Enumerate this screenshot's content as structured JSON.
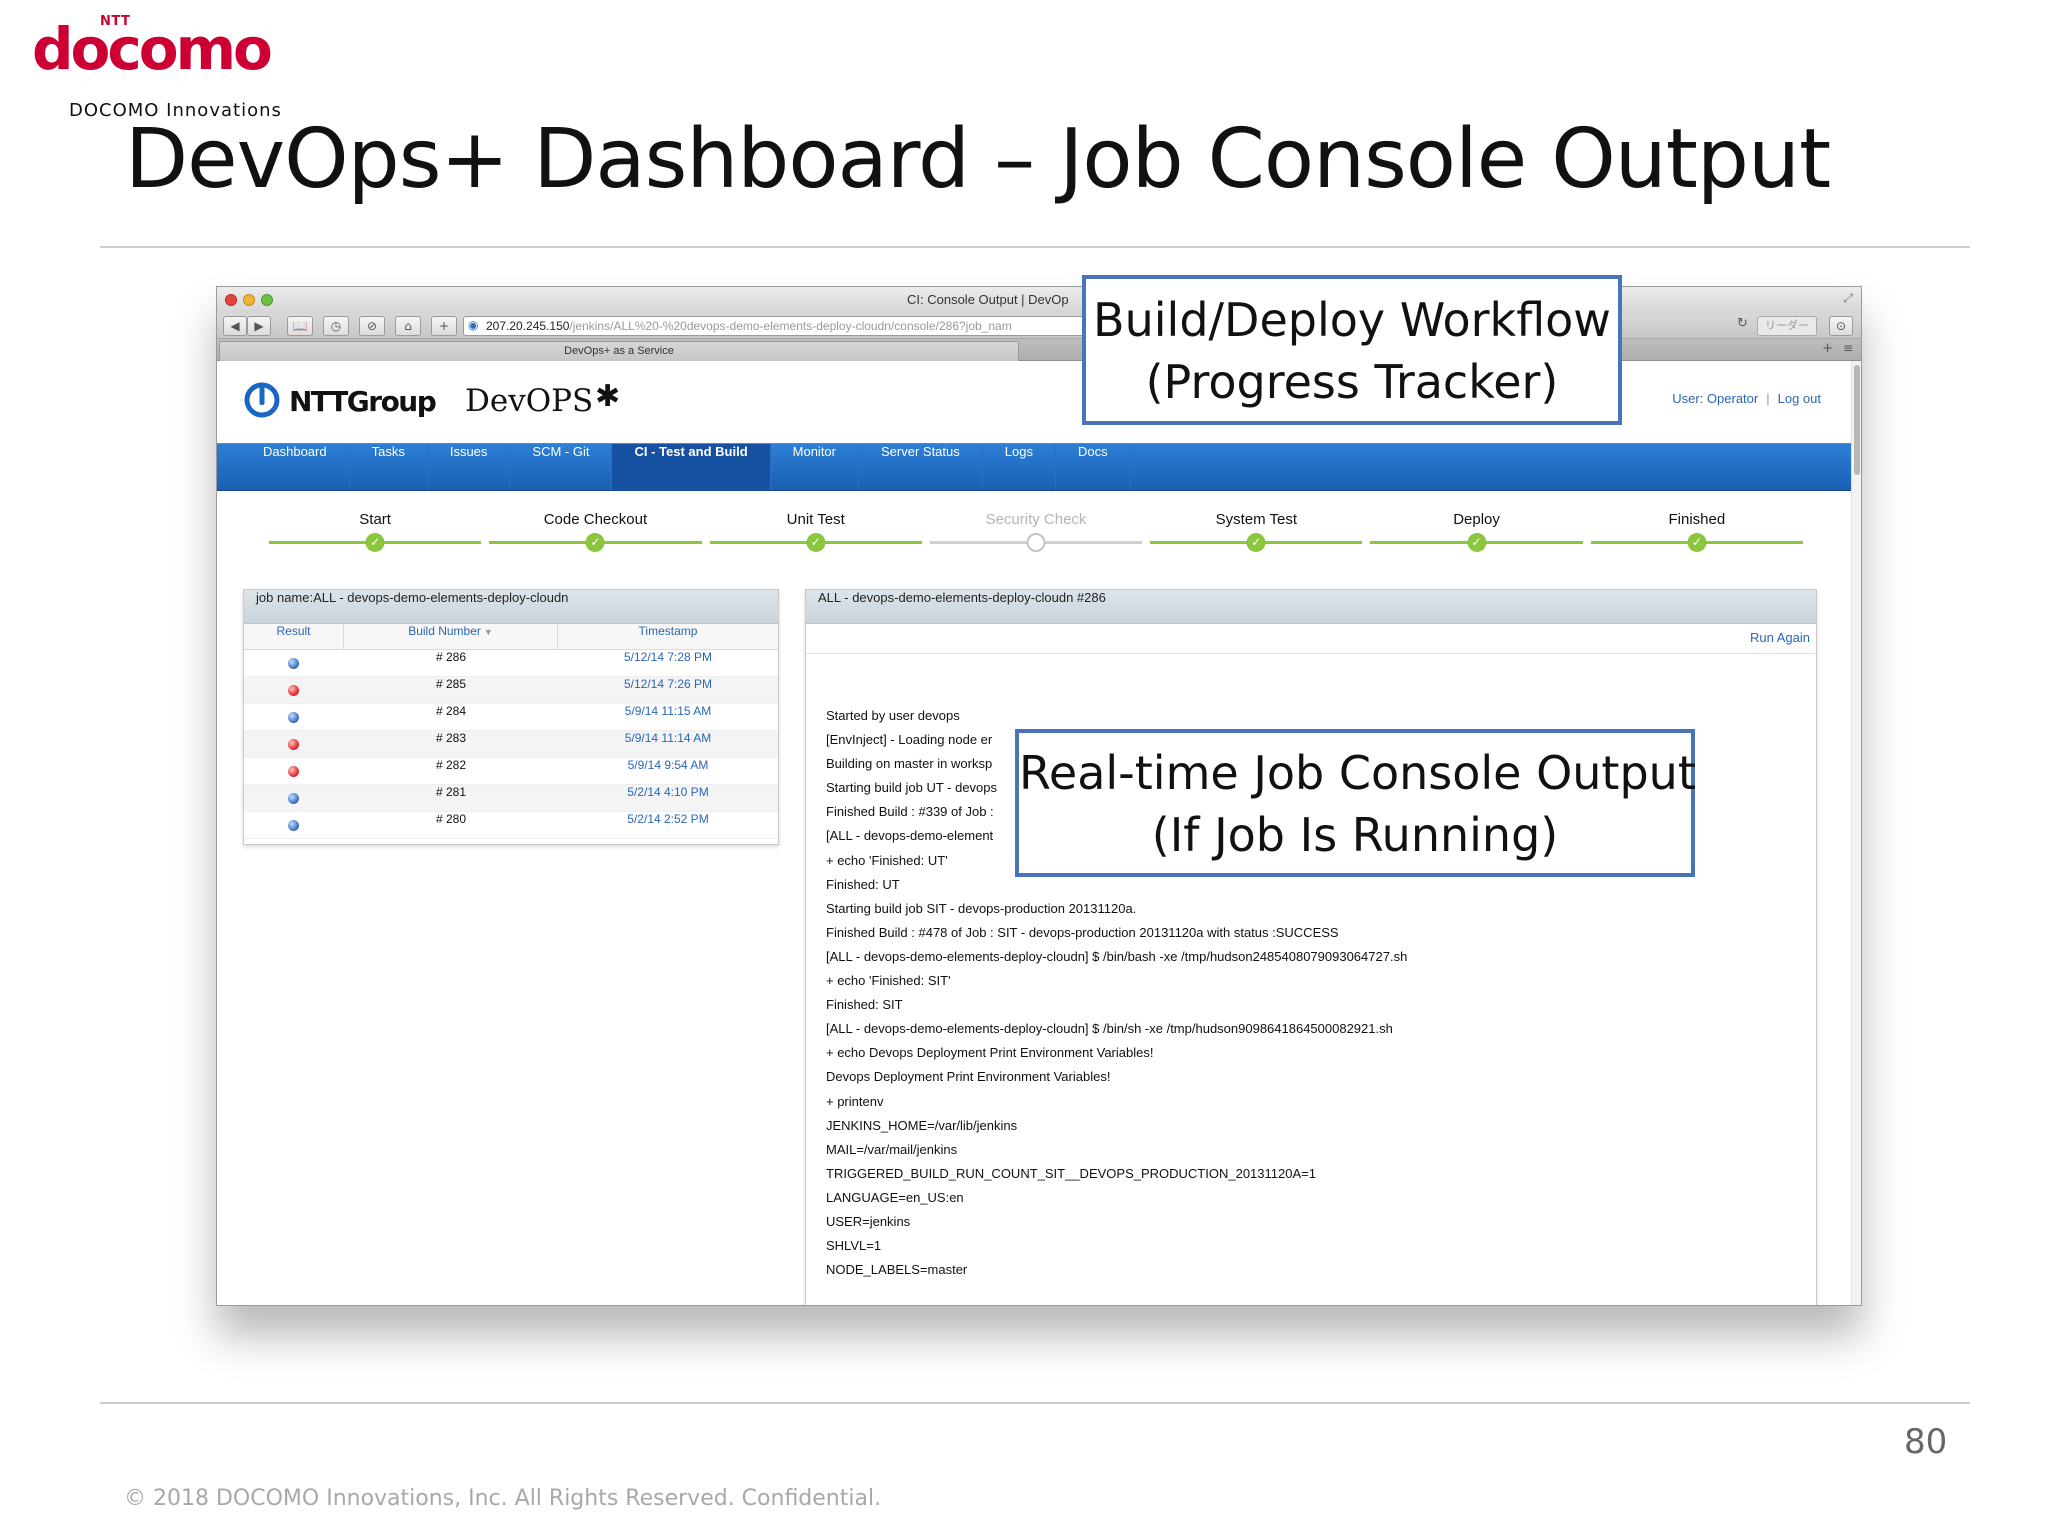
{
  "slide": {
    "logo_ntt": "NTT",
    "logo_word": "docomo",
    "logo_sub": "DOCOMO Innovations",
    "title": "DevOps+ Dashboard – Job Console Output",
    "page_number": "80",
    "copyright": "© 2018 DOCOMO Innovations, Inc. All Rights Reserved. Confidential."
  },
  "browser": {
    "window_title": "CI: Console Output | DevOp",
    "url_host": "207.20.245.150",
    "url_path": "/jenkins/ALL%20-%20devops-demo-elements-deploy-cloudn/console/286?job_nam",
    "tab_title": "DevOps+ as a Service",
    "reader_label": "リーダー",
    "toolbar_back": "◀",
    "toolbar_forward": "▶",
    "toolbar_bookmarks": "📖",
    "toolbar_history": "◷",
    "toolbar_share": "⊘",
    "toolbar_home": "⌂",
    "toolbar_add": "+",
    "tab_add": "+",
    "tab_list": "≡"
  },
  "app": {
    "brand_ntt": "NTTGroup",
    "brand_product": "DevOPS",
    "user_label": "User: Operator",
    "logout_label": "Log out",
    "nav": [
      {
        "label": "Dashboard"
      },
      {
        "label": "Tasks"
      },
      {
        "label": "Issues"
      },
      {
        "label": "SCM - Git"
      },
      {
        "label": "CI - Test and Build"
      },
      {
        "label": "Monitor"
      },
      {
        "label": "Server Status"
      },
      {
        "label": "Logs"
      },
      {
        "label": "Docs"
      }
    ],
    "active_nav": 4,
    "stages": [
      {
        "label": "Start",
        "done": true
      },
      {
        "label": "Code Checkout",
        "done": true
      },
      {
        "label": "Unit Test",
        "done": true
      },
      {
        "label": "Security Check",
        "done": false
      },
      {
        "label": "System Test",
        "done": true
      },
      {
        "label": "Deploy",
        "done": true
      },
      {
        "label": "Finished",
        "done": true
      }
    ],
    "history": {
      "title": "job name:ALL - devops-demo-elements-deploy-cloudn",
      "col_result": "Result",
      "col_build": "Build Number",
      "col_time": "Timestamp",
      "rows": [
        {
          "status": "blue",
          "build": "# 286",
          "time": "5/12/14 7:28 PM"
        },
        {
          "status": "red",
          "build": "# 285",
          "time": "5/12/14 7:26 PM"
        },
        {
          "status": "blue",
          "build": "# 284",
          "time": "5/9/14 11:15 AM"
        },
        {
          "status": "red",
          "build": "# 283",
          "time": "5/9/14 11:14 AM"
        },
        {
          "status": "red",
          "build": "# 282",
          "time": "5/9/14 9:54 AM"
        },
        {
          "status": "blue",
          "build": "# 281",
          "time": "5/2/14 4:10 PM"
        },
        {
          "status": "blue",
          "build": "# 280",
          "time": "5/2/14 2:52 PM"
        }
      ]
    },
    "console": {
      "title": "ALL - devops-demo-elements-deploy-cloudn #286",
      "run_again": "Run Again",
      "lines": [
        "Started by user devops",
        "[EnvInject] - Loading node er",
        "Building on master in worksp",
        "Starting build job UT - devops",
        "Finished Build : #339 of Job :",
        "[ALL - devops-demo-element",
        "+ echo 'Finished: UT'",
        "Finished: UT",
        "Starting build job SIT - devops-production 20131120a.",
        "Finished Build : #478 of Job : SIT - devops-production 20131120a with status :SUCCESS",
        "[ALL - devops-demo-elements-deploy-cloudn] $ /bin/bash -xe /tmp/hudson2485408079093064727.sh",
        "+ echo 'Finished: SIT'",
        "Finished: SIT",
        "[ALL - devops-demo-elements-deploy-cloudn] $ /bin/sh -xe /tmp/hudson9098641864500082921.sh",
        "+ echo Devops Deployment Print Environment Variables!",
        "Devops Deployment Print Environment Variables!",
        "+ printenv",
        "JENKINS_HOME=/var/lib/jenkins",
        "MAIL=/var/mail/jenkins",
        "TRIGGERED_BUILD_RUN_COUNT_SIT__DEVOPS_PRODUCTION_20131120A=1",
        "LANGUAGE=en_US:en",
        "USER=jenkins",
        "SHLVL=1",
        "NODE_LABELS=master"
      ]
    }
  },
  "callouts": {
    "workflow_line1": "Build/Deploy Workflow",
    "workflow_line2": "(Progress Tracker)",
    "console_line1": "Real-time Job Console Output",
    "console_line2": "(If Job Is Running)"
  },
  "colors": {
    "brand_red": "#cc0033",
    "nav_blue": "#1a5fb4",
    "stage_green": "#8cc63f",
    "callout_border": "#4a73b8"
  }
}
